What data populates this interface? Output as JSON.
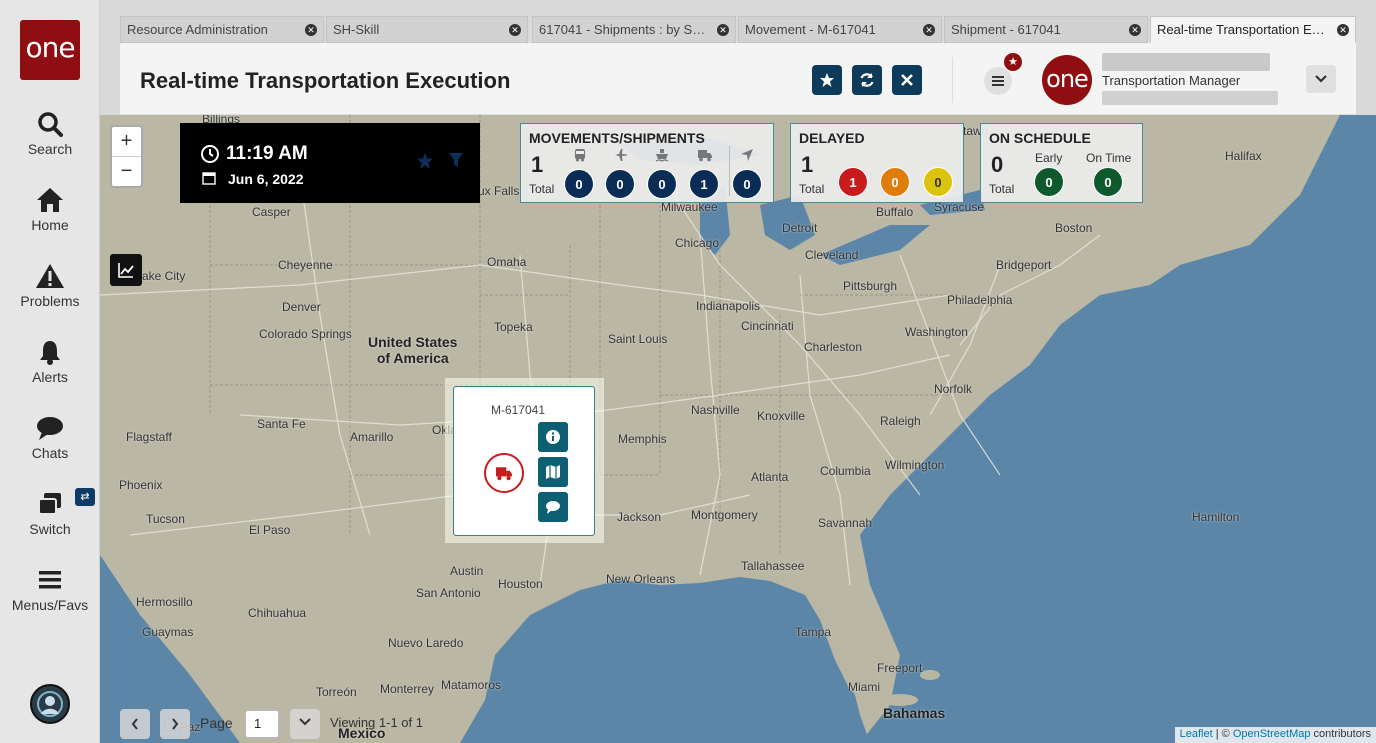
{
  "app": {
    "logo_text": "one"
  },
  "nav": {
    "items": [
      {
        "label": "Search",
        "icon": "search-icon"
      },
      {
        "label": "Home",
        "icon": "home-icon"
      },
      {
        "label": "Problems",
        "icon": "warning-icon"
      },
      {
        "label": "Alerts",
        "icon": "bell-icon"
      },
      {
        "label": "Chats",
        "icon": "chat-icon"
      },
      {
        "label": "Switch",
        "icon": "switch-icon"
      },
      {
        "label": "Menus/Favs",
        "icon": "hamburger-icon"
      }
    ]
  },
  "tabs": [
    {
      "label": "Resource Administration"
    },
    {
      "label": "SH-Skill"
    },
    {
      "label": "617041 - Shipments : by Ship..."
    },
    {
      "label": "Movement - M-617041"
    },
    {
      "label": "Shipment - 617041"
    },
    {
      "label": "Real-time Transportation Exe...",
      "active": true
    }
  ],
  "header": {
    "title": "Real-time Transportation Execution",
    "user_role": "Transportation Manager",
    "profile_logo": "one"
  },
  "time_panel": {
    "time": "11:19 AM",
    "date": "Jun 6, 2022"
  },
  "movements": {
    "title": "MOVEMENTS/SHIPMENTS",
    "total": "1",
    "total_label": "Total",
    "modes": [
      {
        "icon": "bus-icon",
        "count": "0"
      },
      {
        "icon": "plane-icon",
        "count": "0"
      },
      {
        "icon": "ship-icon",
        "count": "0"
      },
      {
        "icon": "truck-icon",
        "count": "1"
      },
      {
        "icon": "location-arrow-icon",
        "count": "0"
      }
    ]
  },
  "delayed": {
    "title": "DELAYED",
    "total": "1",
    "total_label": "Total",
    "levels": [
      {
        "color": "#c81b1b",
        "count": "1"
      },
      {
        "color": "#e07c0c",
        "count": "0"
      },
      {
        "color": "#dcc40e",
        "count": "0"
      }
    ]
  },
  "on_schedule": {
    "title": "ON SCHEDULE",
    "total": "0",
    "total_label": "Total",
    "early_label": "Early",
    "early": "0",
    "ontime_label": "On Time",
    "ontime": "0"
  },
  "popup": {
    "movement_id": "M-617041"
  },
  "pager": {
    "page_label": "Page",
    "page_value": "1",
    "viewing": "Viewing 1-1 of 1"
  },
  "attribution": {
    "leaflet": "Leaflet",
    "sep": " | © ",
    "osm": "OpenStreetMap",
    "suffix": " contributors"
  },
  "map": {
    "country": "United States\nof America",
    "cities": [
      {
        "name": "Billings"
      },
      {
        "name": "Casper"
      },
      {
        "name": "Cheyenne"
      },
      {
        "name": "ake City"
      },
      {
        "name": "Denver"
      },
      {
        "name": "Colorado Springs"
      },
      {
        "name": "Omaha"
      },
      {
        "name": "Topeka"
      },
      {
        "name": "Santa Fe"
      },
      {
        "name": "Amarillo"
      },
      {
        "name": "Okla"
      },
      {
        "name": "Flagstaff"
      },
      {
        "name": "Phoenix"
      },
      {
        "name": "Tucson"
      },
      {
        "name": "El Paso"
      },
      {
        "name": "Hermosillo"
      },
      {
        "name": "Chihuahua"
      },
      {
        "name": "Guaymas"
      },
      {
        "name": "Nuevo Laredo"
      },
      {
        "name": "Torreón"
      },
      {
        "name": "Monterrey"
      },
      {
        "name": "Matamoros"
      },
      {
        "name": "Mexico"
      },
      {
        "name": "La Paz"
      },
      {
        "name": "Austin"
      },
      {
        "name": "San Antonio"
      },
      {
        "name": "Houston"
      },
      {
        "name": "New Orleans"
      },
      {
        "name": "Jackson"
      },
      {
        "name": "Memphis"
      },
      {
        "name": "Montgomery"
      },
      {
        "name": "Atlanta"
      },
      {
        "name": "Tallahassee"
      },
      {
        "name": "Tampa"
      },
      {
        "name": "Miami"
      },
      {
        "name": "Freeport"
      },
      {
        "name": "Bahamas"
      },
      {
        "name": "Savannah"
      },
      {
        "name": "Columbia"
      },
      {
        "name": "Wilmington"
      },
      {
        "name": "Raleigh"
      },
      {
        "name": "Norfolk"
      },
      {
        "name": "Knoxville"
      },
      {
        "name": "Nashville"
      },
      {
        "name": "Saint Louis"
      },
      {
        "name": "Indianapolis"
      },
      {
        "name": "Cincinnati"
      },
      {
        "name": "Charleston"
      },
      {
        "name": "Washington"
      },
      {
        "name": "Philadelphia"
      },
      {
        "name": "Pittsburgh"
      },
      {
        "name": "Cleveland"
      },
      {
        "name": "Detroit"
      },
      {
        "name": "Chicago"
      },
      {
        "name": "Milwaukee"
      },
      {
        "name": "Buffalo"
      },
      {
        "name": "Syracuse"
      },
      {
        "name": "Bridgeport"
      },
      {
        "name": "Boston"
      },
      {
        "name": "Halifax"
      },
      {
        "name": "Hamilton"
      },
      {
        "name": "ux Falls"
      },
      {
        "name": "tawa"
      }
    ]
  }
}
